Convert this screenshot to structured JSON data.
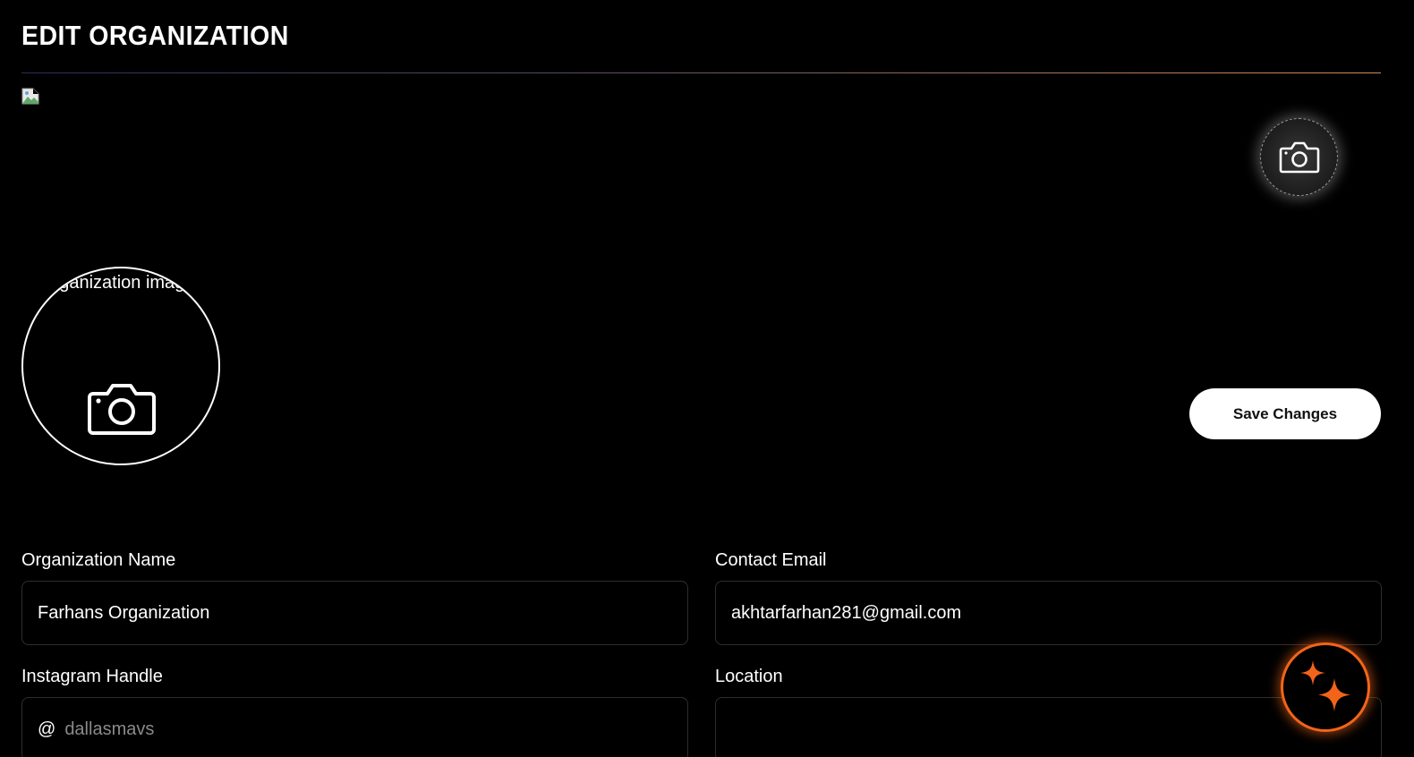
{
  "header": {
    "title": "EDIT ORGANIZATION"
  },
  "cover": {
    "camera_icon": "camera-icon"
  },
  "avatar": {
    "alt_text": "Organization image",
    "camera_icon": "camera-icon"
  },
  "actions": {
    "save_label": "Save Changes"
  },
  "form": {
    "org_name": {
      "label": "Organization Name",
      "value": "Farhans Organization"
    },
    "contact_email": {
      "label": "Contact Email",
      "value": "akhtarfarhan281@gmail.com"
    },
    "instagram": {
      "label": "Instagram Handle",
      "prefix": "@",
      "placeholder": "dallasmavs"
    },
    "location": {
      "label": "Location",
      "value": ""
    }
  },
  "fab": {
    "icon": "sparkles-icon"
  },
  "colors": {
    "background": "#000000",
    "accent": "#f2641a",
    "button_bg": "#ffffff"
  }
}
